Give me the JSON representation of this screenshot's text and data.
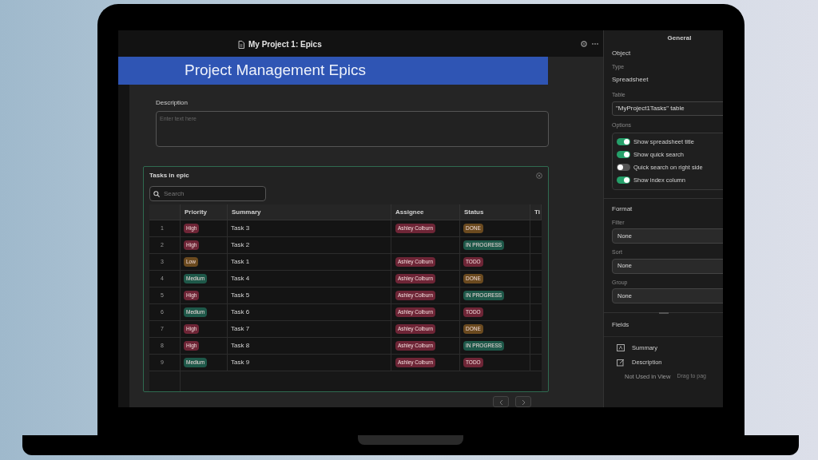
{
  "editor": {
    "title": "My Project 1: Epics",
    "banner_title": "Project Management Epics",
    "description": {
      "label": "Description",
      "placeholder": "Enter text here"
    },
    "tasks_card": {
      "title": "Tasks in epic",
      "search": {
        "placeholder": "Search"
      },
      "table": {
        "columns": [
          "Priority",
          "Summary",
          "Assignee",
          "Status",
          "Ti"
        ],
        "rows": [
          {
            "index": "1",
            "priority": {
              "text": "High",
              "color": "#6e2536"
            },
            "summary": "Task 3",
            "assignee": {
              "text": "Ashley Colburn",
              "color": "#6e2536"
            },
            "status": {
              "text": "DONE",
              "color": "#6b4a1f"
            }
          },
          {
            "index": "2",
            "priority": {
              "text": "High",
              "color": "#6e2536"
            },
            "summary": "Task 2",
            "status": {
              "text": "IN PROGRESS",
              "color": "#1e5849"
            }
          },
          {
            "index": "3",
            "priority": {
              "text": "Low",
              "color": "#6b4a1f"
            },
            "summary": "Task 1",
            "assignee": {
              "text": "Ashley Colburn",
              "color": "#6e2536"
            },
            "status": {
              "text": "TODO",
              "color": "#6e2536"
            }
          },
          {
            "index": "4",
            "priority": {
              "text": "Medium",
              "color": "#1e5849"
            },
            "summary": "Task 4",
            "assignee": {
              "text": "Ashley Colburn",
              "color": "#6e2536"
            },
            "status": {
              "text": "DONE",
              "color": "#6b4a1f"
            }
          },
          {
            "index": "5",
            "priority": {
              "text": "High",
              "color": "#6e2536"
            },
            "summary": "Task 5",
            "assignee": {
              "text": "Ashley Colburn",
              "color": "#6e2536"
            },
            "status": {
              "text": "IN PROGRESS",
              "color": "#1e5849"
            }
          },
          {
            "index": "6",
            "priority": {
              "text": "Medium",
              "color": "#1e5849"
            },
            "summary": "Task 6",
            "assignee": {
              "text": "Ashley Colburn",
              "color": "#6e2536"
            },
            "status": {
              "text": "TODO",
              "color": "#6e2536"
            }
          },
          {
            "index": "7",
            "priority": {
              "text": "High",
              "color": "#6e2536"
            },
            "summary": "Task 7",
            "assignee": {
              "text": "Ashley Colburn",
              "color": "#6e2536"
            },
            "status": {
              "text": "DONE",
              "color": "#6b4a1f"
            }
          },
          {
            "index": "8",
            "priority": {
              "text": "High",
              "color": "#6e2536"
            },
            "summary": "Task 8",
            "assignee": {
              "text": "Ashley Colburn",
              "color": "#6e2536"
            },
            "status": {
              "text": "IN PROGRESS",
              "color": "#1e5849"
            }
          },
          {
            "index": "9",
            "priority": {
              "text": "Medium",
              "color": "#1e5849"
            },
            "summary": "Task 9",
            "assignee": {
              "text": "Ashley Colburn",
              "color": "#6e2536"
            },
            "status": {
              "text": "TODO",
              "color": "#6e2536"
            }
          }
        ]
      }
    }
  },
  "panel": {
    "header": "General",
    "object": {
      "heading": "Object",
      "type_label": "Type",
      "type_value": "Spreadsheet",
      "table_label": "Table",
      "table_value": "\"MyProject1Tasks\" table",
      "options_label": "Options",
      "options": [
        {
          "label": "Show spreadsheet title",
          "on": true
        },
        {
          "label": "Show quick search",
          "on": true
        },
        {
          "label": "Quick search on right side",
          "on": false
        },
        {
          "label": "Show index column",
          "on": true
        }
      ]
    },
    "format": {
      "heading": "Format",
      "selects": [
        {
          "label": "Filter",
          "value": "None"
        },
        {
          "label": "Sort",
          "value": "None"
        },
        {
          "label": "Group",
          "value": "None"
        }
      ]
    },
    "fields": {
      "heading": "Fields",
      "items": [
        {
          "label": "Summary",
          "kind": "text"
        },
        {
          "label": "Description",
          "kind": "edit"
        }
      ],
      "unused_label": "Not Used in View",
      "hint": "Drag to pag"
    }
  }
}
